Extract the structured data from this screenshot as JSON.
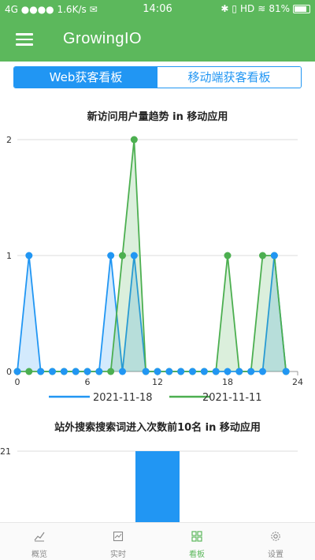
{
  "status_bar": {
    "network": "4G",
    "signal_dots": "●●●●",
    "speed": "1.6K/s",
    "time": "14:06",
    "indicators": "HD",
    "battery": "81%",
    "battery_level": 0.81
  },
  "app_bar": {
    "title": "GrowingIO",
    "menu_icon": "hamburger-menu-icon"
  },
  "tabs": [
    {
      "label": "Web获客看板",
      "active": true
    },
    {
      "label": "移动端获客看板",
      "active": false
    }
  ],
  "colors": {
    "green": "#5cb85c",
    "blue": "#2196f3",
    "series_a": "#2196f3",
    "series_b": "#4caf50"
  },
  "chart_data": [
    {
      "type": "area",
      "title": "新访问用户量趋势 in 移动应用",
      "x": [
        0,
        1,
        2,
        3,
        4,
        5,
        6,
        7,
        8,
        9,
        10,
        11,
        12,
        13,
        14,
        15,
        16,
        17,
        18,
        19,
        20,
        21,
        22,
        23
      ],
      "x_ticks": [
        "0",
        "6",
        "12",
        "18",
        "24"
      ],
      "y_ticks": [
        "0",
        "1",
        "2"
      ],
      "xlim": [
        0,
        24
      ],
      "ylim": [
        0,
        2
      ],
      "series": [
        {
          "name": "2021-11-18",
          "color": "#2196f3",
          "values": [
            0,
            1,
            0,
            0,
            0,
            0,
            0,
            0,
            1,
            0,
            1,
            0,
            0,
            0,
            0,
            0,
            0,
            0,
            0,
            0,
            0,
            0,
            1,
            0
          ]
        },
        {
          "name": "2021-11-11",
          "color": "#4caf50",
          "values": [
            0,
            0,
            0,
            0,
            0,
            0,
            0,
            0,
            0,
            1,
            2,
            0,
            0,
            0,
            0,
            0,
            0,
            0,
            1,
            0,
            0,
            1,
            1,
            0
          ]
        }
      ],
      "grid": true,
      "legend": "bottom"
    },
    {
      "type": "bar",
      "title": "站外搜索搜索词进入次数前10名 in 移动应用",
      "y_ticks": [
        "21"
      ],
      "values": [
        21
      ],
      "ylim": [
        0,
        21
      ],
      "color": "#2196f3"
    }
  ],
  "bottom_nav": [
    {
      "label": "概览",
      "icon": "chart-line-icon",
      "active": false
    },
    {
      "label": "实时",
      "icon": "realtime-icon",
      "active": false
    },
    {
      "label": "看板",
      "icon": "dashboard-grid-icon",
      "active": true
    },
    {
      "label": "设置",
      "icon": "gear-icon",
      "active": false
    }
  ]
}
